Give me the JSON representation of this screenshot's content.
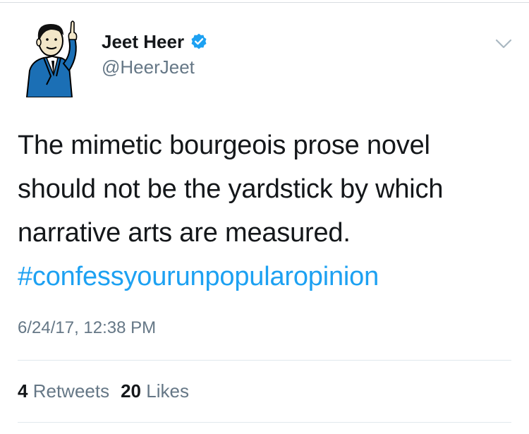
{
  "tweet": {
    "author": {
      "display_name": "Jeet Heer",
      "handle": "@HeerJeet",
      "verified": true,
      "avatar_icon": "cartoon-man-pointing-avatar"
    },
    "text_lines": [
      "The mimetic bourgeois prose novel",
      "should not be the yardstick by which",
      "narrative arts are measured."
    ],
    "hashtag": "#confessyourunpopularopinion",
    "timestamp": "6/24/17, 12:38 PM",
    "stats": {
      "retweets_count": "4",
      "retweets_label": "Retweets",
      "likes_count": "20",
      "likes_label": "Likes"
    }
  },
  "colors": {
    "accent": "#1da1f2",
    "secondary_text": "#657786",
    "primary_text": "#14171a",
    "divider": "#e1e8ed"
  }
}
